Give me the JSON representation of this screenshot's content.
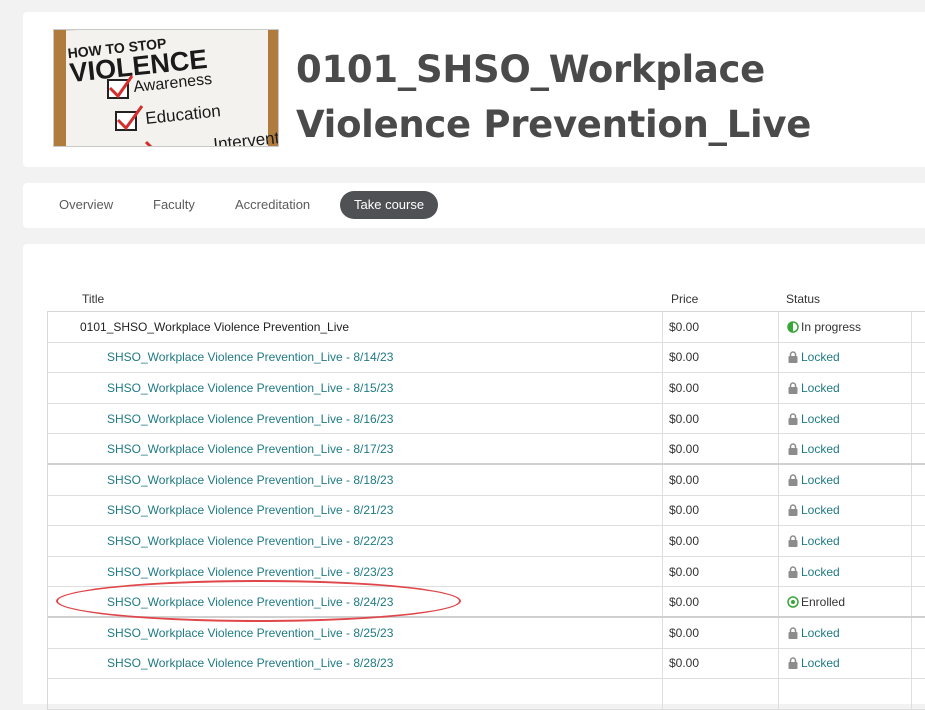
{
  "course": {
    "title": "0101_SHSO_Workplace Violence Prevention_Live",
    "image": {
      "heading_line1": "HOW TO STOP",
      "heading_line2": "VIOLENCE",
      "items": [
        "Awareness",
        "Education",
        "Intervention"
      ]
    }
  },
  "tabs": [
    {
      "label": "Overview",
      "active": false
    },
    {
      "label": "Faculty",
      "active": false
    },
    {
      "label": "Accreditation",
      "active": false
    },
    {
      "label": "Take course",
      "active": true
    }
  ],
  "table": {
    "headers": {
      "title": "Title",
      "price": "Price",
      "status": "Status"
    },
    "rows": [
      {
        "title": "0101_SHSO_Workplace Violence Prevention_Live",
        "price": "$0.00",
        "status": "In progress",
        "status_icon": "half-circle-icon",
        "parent": true
      },
      {
        "title": "SHSO_Workplace Violence Prevention_Live - 8/14/23",
        "price": "$0.00",
        "status": "Locked",
        "status_icon": "lock-icon"
      },
      {
        "title": "SHSO_Workplace Violence Prevention_Live - 8/15/23",
        "price": "$0.00",
        "status": "Locked",
        "status_icon": "lock-icon"
      },
      {
        "title": "SHSO_Workplace Violence Prevention_Live - 8/16/23",
        "price": "$0.00",
        "status": "Locked",
        "status_icon": "lock-icon"
      },
      {
        "title": "SHSO_Workplace Violence Prevention_Live - 8/17/23",
        "price": "$0.00",
        "status": "Locked",
        "status_icon": "lock-icon"
      },
      {
        "title": "SHSO_Workplace Violence Prevention_Live - 8/18/23",
        "price": "$0.00",
        "status": "Locked",
        "status_icon": "lock-icon"
      },
      {
        "title": "SHSO_Workplace Violence Prevention_Live - 8/21/23",
        "price": "$0.00",
        "status": "Locked",
        "status_icon": "lock-icon"
      },
      {
        "title": "SHSO_Workplace Violence Prevention_Live - 8/22/23",
        "price": "$0.00",
        "status": "Locked",
        "status_icon": "lock-icon"
      },
      {
        "title": "SHSO_Workplace Violence Prevention_Live - 8/23/23",
        "price": "$0.00",
        "status": "Locked",
        "status_icon": "lock-icon"
      },
      {
        "title": "SHSO_Workplace Violence Prevention_Live - 8/24/23",
        "price": "$0.00",
        "status": "Enrolled",
        "status_icon": "target-circle-icon",
        "highlighted": true
      },
      {
        "title": "SHSO_Workplace Violence Prevention_Live - 8/25/23",
        "price": "$0.00",
        "status": "Locked",
        "status_icon": "lock-icon"
      },
      {
        "title": "SHSO_Workplace Violence Prevention_Live - 8/28/23",
        "price": "$0.00",
        "status": "Locked",
        "status_icon": "lock-icon"
      },
      {
        "title": "",
        "price": "",
        "status": "",
        "status_icon": ""
      }
    ]
  },
  "colors": {
    "background": "#f2f2f2",
    "title_text": "#4a4a4a",
    "link_teal": "#1f7a84",
    "active_tab": "#4f5155",
    "status_green": "#3aa63a",
    "highlight_oval": "#e0474a"
  }
}
